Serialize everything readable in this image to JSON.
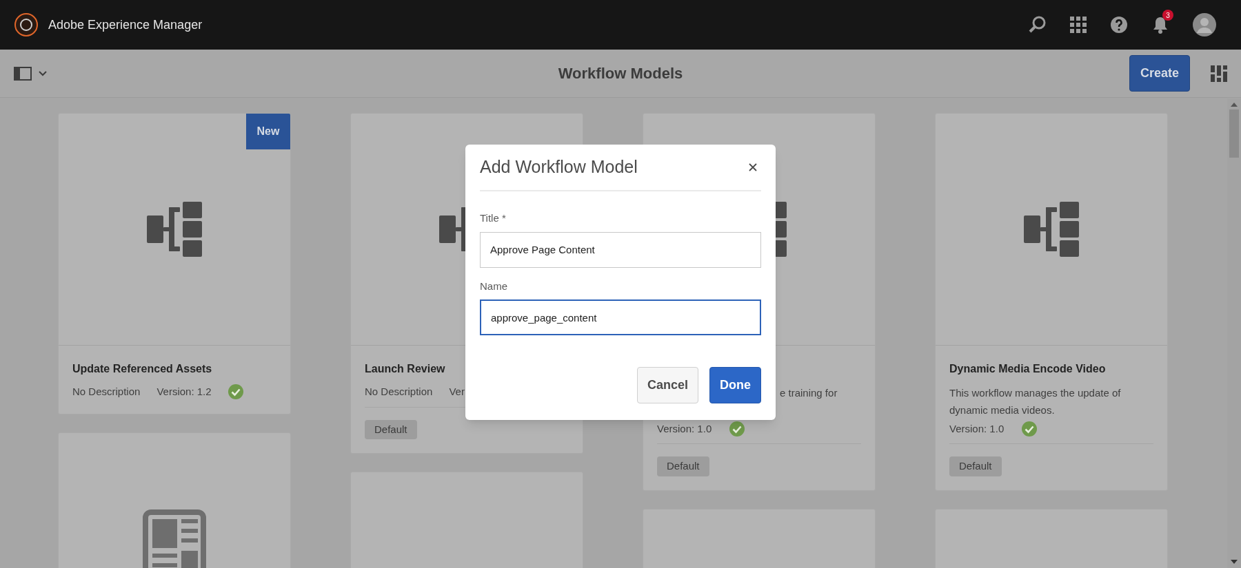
{
  "header": {
    "product": "Adobe Experience Manager",
    "notification_count": "3"
  },
  "toolbar": {
    "title": "Workflow Models",
    "create_button": "Create"
  },
  "columns": [
    [
      {
        "kind": "workflow",
        "badge": "New",
        "title": "Update Referenced Assets",
        "meta": {
          "kind": "inline",
          "description": "No Description",
          "version": "Version: 1.2",
          "published": true
        }
      },
      {
        "kind": "document"
      }
    ],
    [
      {
        "kind": "workflow",
        "title": "Launch Review",
        "meta": {
          "kind": "inline",
          "description": "No Description",
          "version": "Ver"
        },
        "tag": "Default"
      },
      {
        "kind": "workflow"
      }
    ],
    [
      {
        "kind": "workflow",
        "meta": {
          "kind": "offset",
          "description": "e training for",
          "version": "Version: 1.0",
          "published": true
        },
        "tag": "Default"
      },
      {
        "kind": "blank"
      }
    ],
    [
      {
        "kind": "workflow",
        "title": "Dynamic Media Encode Video",
        "meta": {
          "kind": "stacked",
          "description": "This workflow manages the update of dynamic media videos.",
          "version": "Version: 1.0",
          "published": true
        },
        "tag": "Default"
      },
      {
        "kind": "blank"
      }
    ]
  ],
  "dialog": {
    "title": "Add Workflow Model",
    "fields": [
      {
        "label": "Title *",
        "value": "Approve Page Content",
        "focused": false
      },
      {
        "label": "Name",
        "value": "approve_page_content",
        "focused": true
      }
    ],
    "buttons": [
      {
        "label": "Cancel",
        "kind": "secondary"
      },
      {
        "label": "Done",
        "kind": "primary"
      }
    ]
  }
}
